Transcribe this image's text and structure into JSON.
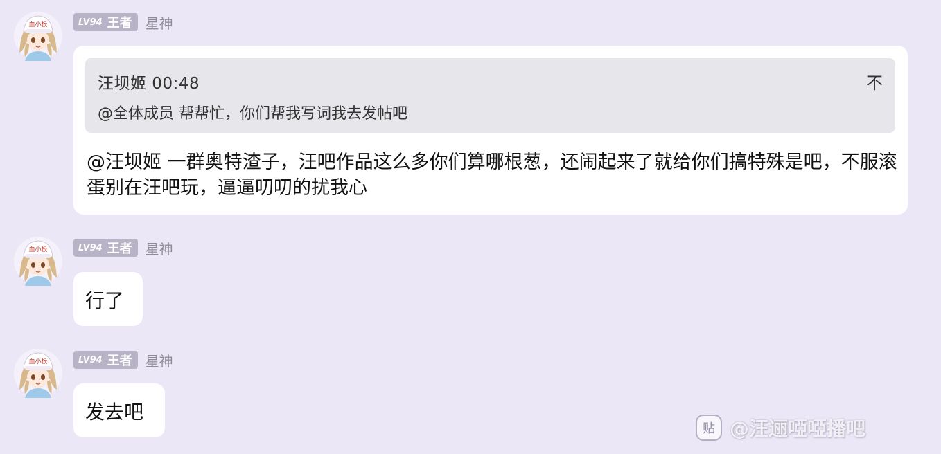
{
  "messages": [
    {
      "badge_level": "LV94",
      "badge_rank": "王者",
      "nickname": "星神",
      "avatar_cap_text": "血小板",
      "reply": {
        "quoted_author_time": "汪坝姬 00:48",
        "quoted_text": "@全体成员 帮帮忙，你们帮我写词我去发帖吧",
        "toggle_glyph": "不"
      },
      "text": "@汪坝姬 一群奥特渣子，汪吧作品这么多你们算哪根葱，还闹起来了就给你们搞特殊是吧，不服滚蛋别在汪吧玩，逼逼叨叨的扰我心"
    },
    {
      "badge_level": "LV94",
      "badge_rank": "王者",
      "nickname": "星神",
      "avatar_cap_text": "血小板",
      "text": "行了"
    },
    {
      "badge_level": "LV94",
      "badge_rank": "王者",
      "nickname": "星神",
      "avatar_cap_text": "血小板",
      "text": "发去吧"
    }
  ],
  "watermark": {
    "icon_text": "贴",
    "text": "@汪逦啞啞播吧"
  },
  "colors": {
    "background": "#ebe7f6",
    "bubble": "#ffffff",
    "quote_background": "#e7e6ea",
    "badge": "#b8b3c6",
    "nickname": "#8f8b97"
  }
}
